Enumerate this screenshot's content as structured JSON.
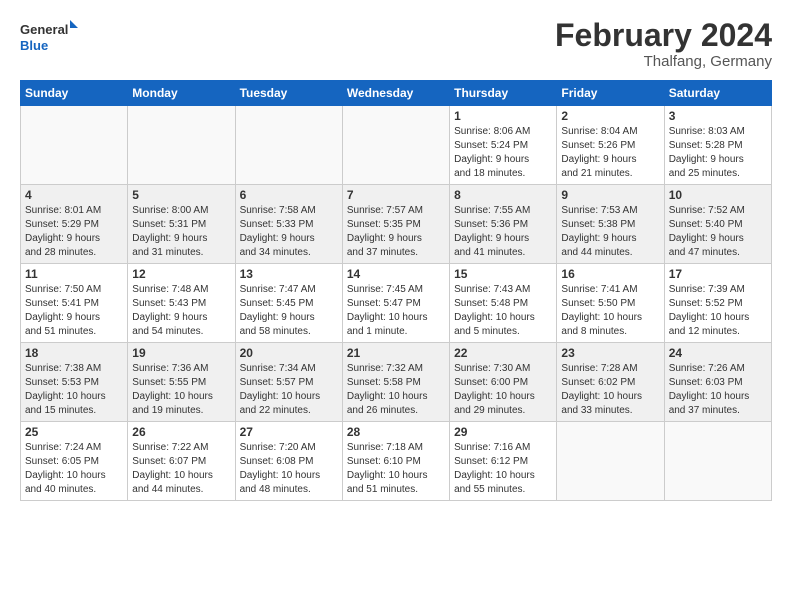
{
  "logo": {
    "line1": "General",
    "line2": "Blue"
  },
  "title": "February 2024",
  "location": "Thalfang, Germany",
  "headers": [
    "Sunday",
    "Monday",
    "Tuesday",
    "Wednesday",
    "Thursday",
    "Friday",
    "Saturday"
  ],
  "weeks": [
    [
      {
        "day": "",
        "info": ""
      },
      {
        "day": "",
        "info": ""
      },
      {
        "day": "",
        "info": ""
      },
      {
        "day": "",
        "info": ""
      },
      {
        "day": "1",
        "info": "Sunrise: 8:06 AM\nSunset: 5:24 PM\nDaylight: 9 hours\nand 18 minutes."
      },
      {
        "day": "2",
        "info": "Sunrise: 8:04 AM\nSunset: 5:26 PM\nDaylight: 9 hours\nand 21 minutes."
      },
      {
        "day": "3",
        "info": "Sunrise: 8:03 AM\nSunset: 5:28 PM\nDaylight: 9 hours\nand 25 minutes."
      }
    ],
    [
      {
        "day": "4",
        "info": "Sunrise: 8:01 AM\nSunset: 5:29 PM\nDaylight: 9 hours\nand 28 minutes."
      },
      {
        "day": "5",
        "info": "Sunrise: 8:00 AM\nSunset: 5:31 PM\nDaylight: 9 hours\nand 31 minutes."
      },
      {
        "day": "6",
        "info": "Sunrise: 7:58 AM\nSunset: 5:33 PM\nDaylight: 9 hours\nand 34 minutes."
      },
      {
        "day": "7",
        "info": "Sunrise: 7:57 AM\nSunset: 5:35 PM\nDaylight: 9 hours\nand 37 minutes."
      },
      {
        "day": "8",
        "info": "Sunrise: 7:55 AM\nSunset: 5:36 PM\nDaylight: 9 hours\nand 41 minutes."
      },
      {
        "day": "9",
        "info": "Sunrise: 7:53 AM\nSunset: 5:38 PM\nDaylight: 9 hours\nand 44 minutes."
      },
      {
        "day": "10",
        "info": "Sunrise: 7:52 AM\nSunset: 5:40 PM\nDaylight: 9 hours\nand 47 minutes."
      }
    ],
    [
      {
        "day": "11",
        "info": "Sunrise: 7:50 AM\nSunset: 5:41 PM\nDaylight: 9 hours\nand 51 minutes."
      },
      {
        "day": "12",
        "info": "Sunrise: 7:48 AM\nSunset: 5:43 PM\nDaylight: 9 hours\nand 54 minutes."
      },
      {
        "day": "13",
        "info": "Sunrise: 7:47 AM\nSunset: 5:45 PM\nDaylight: 9 hours\nand 58 minutes."
      },
      {
        "day": "14",
        "info": "Sunrise: 7:45 AM\nSunset: 5:47 PM\nDaylight: 10 hours\nand 1 minute."
      },
      {
        "day": "15",
        "info": "Sunrise: 7:43 AM\nSunset: 5:48 PM\nDaylight: 10 hours\nand 5 minutes."
      },
      {
        "day": "16",
        "info": "Sunrise: 7:41 AM\nSunset: 5:50 PM\nDaylight: 10 hours\nand 8 minutes."
      },
      {
        "day": "17",
        "info": "Sunrise: 7:39 AM\nSunset: 5:52 PM\nDaylight: 10 hours\nand 12 minutes."
      }
    ],
    [
      {
        "day": "18",
        "info": "Sunrise: 7:38 AM\nSunset: 5:53 PM\nDaylight: 10 hours\nand 15 minutes."
      },
      {
        "day": "19",
        "info": "Sunrise: 7:36 AM\nSunset: 5:55 PM\nDaylight: 10 hours\nand 19 minutes."
      },
      {
        "day": "20",
        "info": "Sunrise: 7:34 AM\nSunset: 5:57 PM\nDaylight: 10 hours\nand 22 minutes."
      },
      {
        "day": "21",
        "info": "Sunrise: 7:32 AM\nSunset: 5:58 PM\nDaylight: 10 hours\nand 26 minutes."
      },
      {
        "day": "22",
        "info": "Sunrise: 7:30 AM\nSunset: 6:00 PM\nDaylight: 10 hours\nand 29 minutes."
      },
      {
        "day": "23",
        "info": "Sunrise: 7:28 AM\nSunset: 6:02 PM\nDaylight: 10 hours\nand 33 minutes."
      },
      {
        "day": "24",
        "info": "Sunrise: 7:26 AM\nSunset: 6:03 PM\nDaylight: 10 hours\nand 37 minutes."
      }
    ],
    [
      {
        "day": "25",
        "info": "Sunrise: 7:24 AM\nSunset: 6:05 PM\nDaylight: 10 hours\nand 40 minutes."
      },
      {
        "day": "26",
        "info": "Sunrise: 7:22 AM\nSunset: 6:07 PM\nDaylight: 10 hours\nand 44 minutes."
      },
      {
        "day": "27",
        "info": "Sunrise: 7:20 AM\nSunset: 6:08 PM\nDaylight: 10 hours\nand 48 minutes."
      },
      {
        "day": "28",
        "info": "Sunrise: 7:18 AM\nSunset: 6:10 PM\nDaylight: 10 hours\nand 51 minutes."
      },
      {
        "day": "29",
        "info": "Sunrise: 7:16 AM\nSunset: 6:12 PM\nDaylight: 10 hours\nand 55 minutes."
      },
      {
        "day": "",
        "info": ""
      },
      {
        "day": "",
        "info": ""
      }
    ]
  ]
}
